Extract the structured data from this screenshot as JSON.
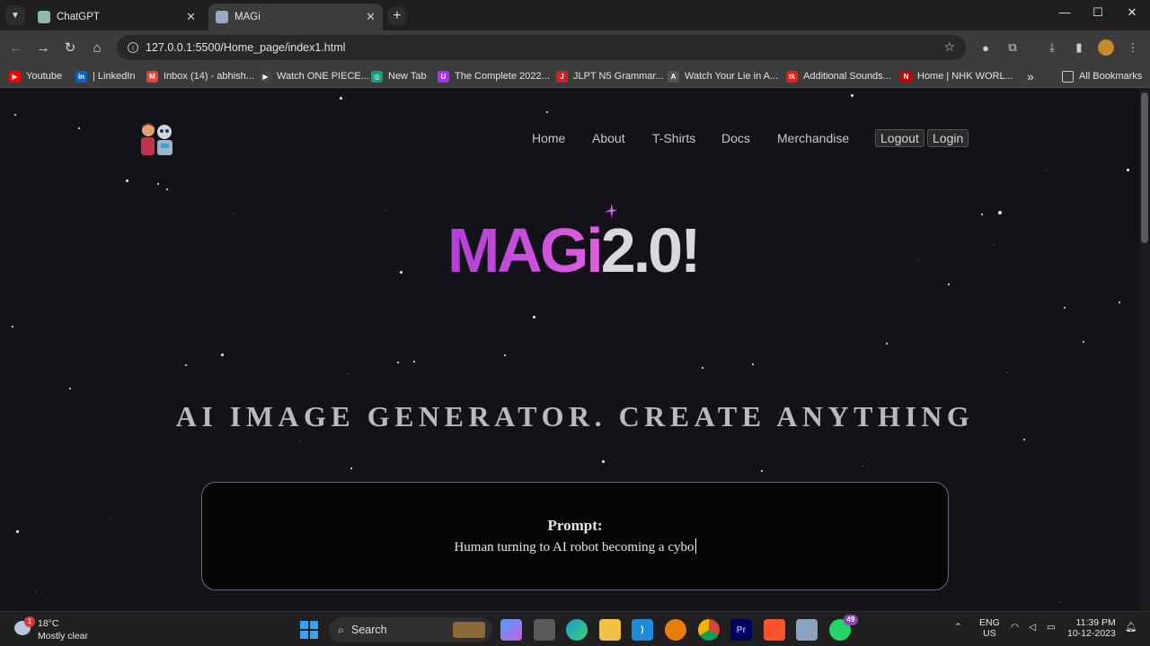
{
  "browser": {
    "tabs": [
      {
        "title": "ChatGPT",
        "active": false
      },
      {
        "title": "MAGi",
        "active": true
      }
    ],
    "url": "127.0.0.1:5500/Home_page/index1.html",
    "bookmarks": [
      {
        "label": "Youtube",
        "color": "#ff0000",
        "icon": "youtube-icon"
      },
      {
        "label": "| LinkedIn",
        "color": "#0a66c2",
        "icon": "linkedin-icon"
      },
      {
        "label": "Inbox (14) - abhish...",
        "color": "#ea4335",
        "icon": "gmail-icon"
      },
      {
        "label": "Watch ONE PIECE...",
        "color": "#444444",
        "icon": "play-icon"
      },
      {
        "label": "New Tab",
        "color": "#10a37f",
        "icon": "chatgpt-icon"
      },
      {
        "label": "The Complete 2022...",
        "color": "#a435f0",
        "icon": "udemy-icon"
      },
      {
        "label": "JLPT N5 Grammar...",
        "color": "#d31f26",
        "icon": "j-icon"
      },
      {
        "label": "Watch Your Lie in A...",
        "color": "#bbbbbb",
        "icon": "anime-icon"
      },
      {
        "label": "Additional Sounds...",
        "color": "#e62117",
        "icon": "tk-icon"
      },
      {
        "label": "Home | NHK WORL...",
        "color": "#cc0000",
        "icon": "nhk-icon"
      }
    ],
    "all_bookmarks": "All Bookmarks"
  },
  "site": {
    "nav": [
      "Home",
      "About",
      "T-Shirts",
      "Docs",
      "Merchandise"
    ],
    "logout": "Logout",
    "login": "Login",
    "brand_main": "MAGi",
    "brand_version": "2.0!",
    "tagline": "AI IMAGE GENERATOR. CREATE ANYTHING",
    "prompt_label": "Prompt:",
    "prompt_value": "Human turning to AI robot becoming a cybo",
    "accent": "#c84ee0"
  },
  "taskbar": {
    "weather_temp": "18°C",
    "weather_desc": "Mostly clear",
    "weather_badge": "1",
    "search_label": "Search",
    "whatsapp_badge": "49",
    "lang_line1": "ENG",
    "lang_line2": "US",
    "time": "11:39 PM",
    "date": "10-12-2023"
  }
}
